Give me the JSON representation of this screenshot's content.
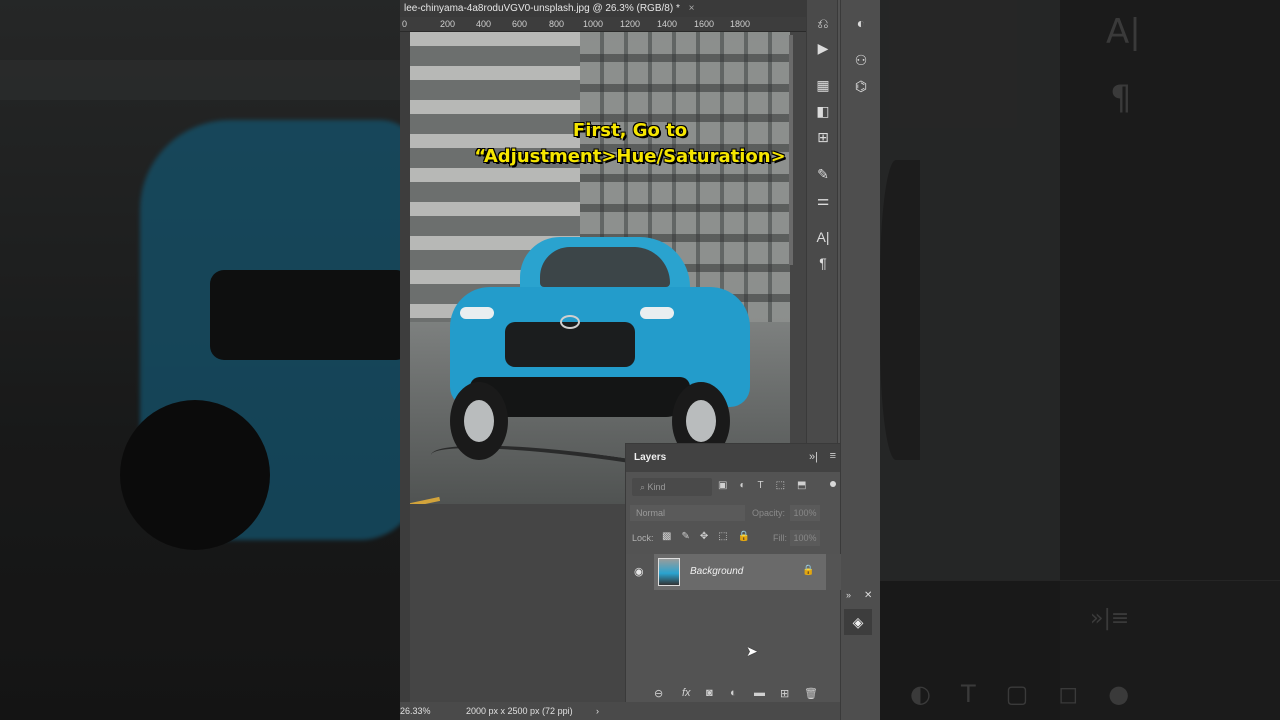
{
  "document": {
    "tab_title": "lee-chinyama-4a8roduVGV0-unsplash.jpg @ 26.3% (RGB/8) *",
    "close_glyph": "×"
  },
  "ruler": {
    "ticks": [
      "0",
      "200",
      "400",
      "600",
      "800",
      "1000",
      "1200",
      "1400",
      "1600",
      "1800"
    ]
  },
  "caption": {
    "line1": "First, Go to",
    "line2": "“Adjustment>Hue/Saturation>"
  },
  "tools": [
    {
      "icon": "history-icon"
    },
    {
      "icon": "play-action-icon"
    },
    {
      "icon": "table-icon"
    },
    {
      "icon": "gradient-icon"
    },
    {
      "icon": "grid-icon"
    },
    {
      "icon": "brush-settings-icon"
    },
    {
      "icon": "adjust-sliders-icon"
    },
    {
      "icon": "character-icon"
    },
    {
      "icon": "paragraph-icon"
    }
  ],
  "tools2": [
    {
      "icon": "adjustments-icon"
    },
    {
      "icon": "channels-icon"
    },
    {
      "icon": "paths-icon"
    }
  ],
  "layers_panel": {
    "title": "Layers",
    "kind_placeholder": "Kind",
    "blend_mode": "Normal",
    "opacity_label": "Opacity:",
    "opacity_value": "100%",
    "lock_label": "Lock:",
    "fill_label": "Fill:",
    "fill_value": "100%",
    "layers": [
      {
        "name": "Background",
        "visible": true,
        "locked": true
      }
    ],
    "footer_icons": [
      "link-icon",
      "fx-icon",
      "mask-icon",
      "adjustment-layer-icon",
      "folder-icon",
      "new-layer-icon",
      "trash-icon"
    ]
  },
  "status": {
    "zoom": "26.33%",
    "size": "2000 px x 2500 px (72 ppi)",
    "arrow": "›"
  },
  "colors": {
    "caption": "#f6e600",
    "panel_bg": "#535353",
    "car_blue": "#239ccb"
  }
}
